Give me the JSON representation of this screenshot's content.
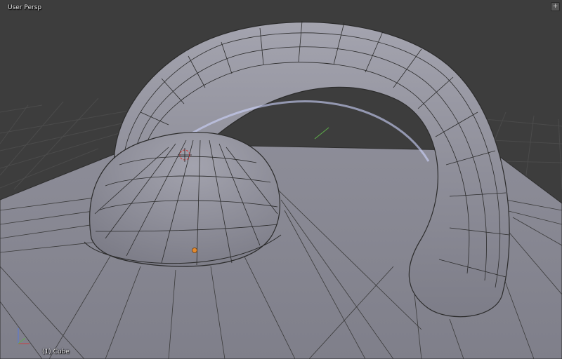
{
  "viewport": {
    "view_label": "User Persp",
    "object_label": "(1) Cube",
    "corner_icon": "plus-icon",
    "corner_glyph": "+"
  },
  "scene": {
    "background": "#3d3d3d",
    "grid_color": "#4a4a4a",
    "mesh_color": "#8a8a95",
    "wire_color": "#2b2b2b",
    "selection_glow": "#cfd6ff",
    "cursor_color": "#d04040",
    "origin_color": "#e38a2e",
    "axis_x_color": "#c84040",
    "axis_y_color": "#5fb04a",
    "axis_z_color": "#5577dd"
  }
}
